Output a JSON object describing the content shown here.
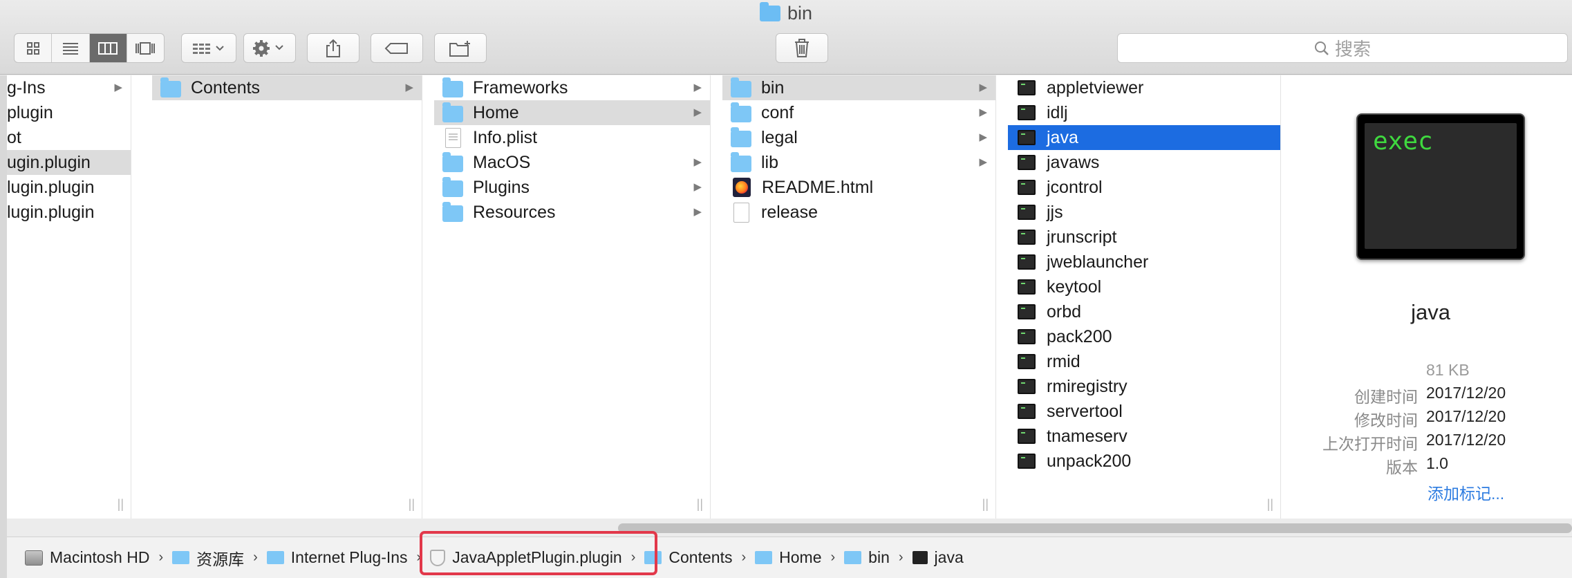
{
  "window": {
    "title": "bin"
  },
  "toolbar": {
    "search_placeholder": "搜索"
  },
  "columns": {
    "col1": [
      {
        "label": "g-Ins",
        "arrow": true
      },
      {
        "label": "plugin"
      },
      {
        "label": "ot"
      },
      {
        "label": "ugin.plugin",
        "selected": true
      },
      {
        "label": "lugin.plugin"
      },
      {
        "label": "lugin.plugin"
      }
    ],
    "col2": [
      {
        "label": "Contents",
        "icon": "folder",
        "arrow": true,
        "selected": "gray"
      }
    ],
    "col3": [
      {
        "label": "Frameworks",
        "icon": "folder",
        "arrow": true
      },
      {
        "label": "Home",
        "icon": "folder",
        "arrow": true,
        "selected": "gray"
      },
      {
        "label": "Info.plist",
        "icon": "plist"
      },
      {
        "label": "MacOS",
        "icon": "folder",
        "arrow": true
      },
      {
        "label": "Plugins",
        "icon": "folder",
        "arrow": true
      },
      {
        "label": "Resources",
        "icon": "folder",
        "arrow": true
      }
    ],
    "col4": [
      {
        "label": "bin",
        "icon": "folder",
        "arrow": true,
        "selected": "gray"
      },
      {
        "label": "conf",
        "icon": "folder",
        "arrow": true
      },
      {
        "label": "legal",
        "icon": "folder",
        "arrow": true
      },
      {
        "label": "lib",
        "icon": "folder",
        "arrow": true
      },
      {
        "label": "README.html",
        "icon": "html"
      },
      {
        "label": "release",
        "icon": "doc"
      }
    ],
    "col5": [
      {
        "label": "appletviewer",
        "icon": "term"
      },
      {
        "label": "idlj",
        "icon": "term"
      },
      {
        "label": "java",
        "icon": "term",
        "selected": "blue"
      },
      {
        "label": "javaws",
        "icon": "term"
      },
      {
        "label": "jcontrol",
        "icon": "term"
      },
      {
        "label": "jjs",
        "icon": "term"
      },
      {
        "label": "jrunscript",
        "icon": "term"
      },
      {
        "label": "jweblauncher",
        "icon": "term"
      },
      {
        "label": "keytool",
        "icon": "term"
      },
      {
        "label": "orbd",
        "icon": "term"
      },
      {
        "label": "pack200",
        "icon": "term"
      },
      {
        "label": "rmid",
        "icon": "term"
      },
      {
        "label": "rmiregistry",
        "icon": "term"
      },
      {
        "label": "servertool",
        "icon": "term"
      },
      {
        "label": "tnameserv",
        "icon": "term"
      },
      {
        "label": "unpack200",
        "icon": "term"
      }
    ]
  },
  "preview": {
    "icon_text": "exec",
    "name": "java",
    "size": "81 KB",
    "created_label": "创建时间",
    "created": "2017/12/20",
    "modified_label": "修改时间",
    "modified": "2017/12/20",
    "opened_label": "上次打开时间",
    "opened": "2017/12/20",
    "version_label": "版本",
    "version": "1.0",
    "add_tags": "添加标记..."
  },
  "pathbar": [
    {
      "label": "Macintosh HD",
      "icon": "disk"
    },
    {
      "label": "资源库",
      "icon": "lib"
    },
    {
      "label": "Internet Plug-Ins",
      "icon": "folder"
    },
    {
      "label": "JavaAppletPlugin.plugin",
      "icon": "shield"
    },
    {
      "label": "Contents",
      "icon": "folder"
    },
    {
      "label": "Home",
      "icon": "folder"
    },
    {
      "label": "bin",
      "icon": "folder"
    },
    {
      "label": "java",
      "icon": "term"
    }
  ],
  "colors": {
    "selection_blue": "#1c6ce1",
    "folder_blue": "#7ec7f6",
    "highlight_red": "#e2384a"
  }
}
